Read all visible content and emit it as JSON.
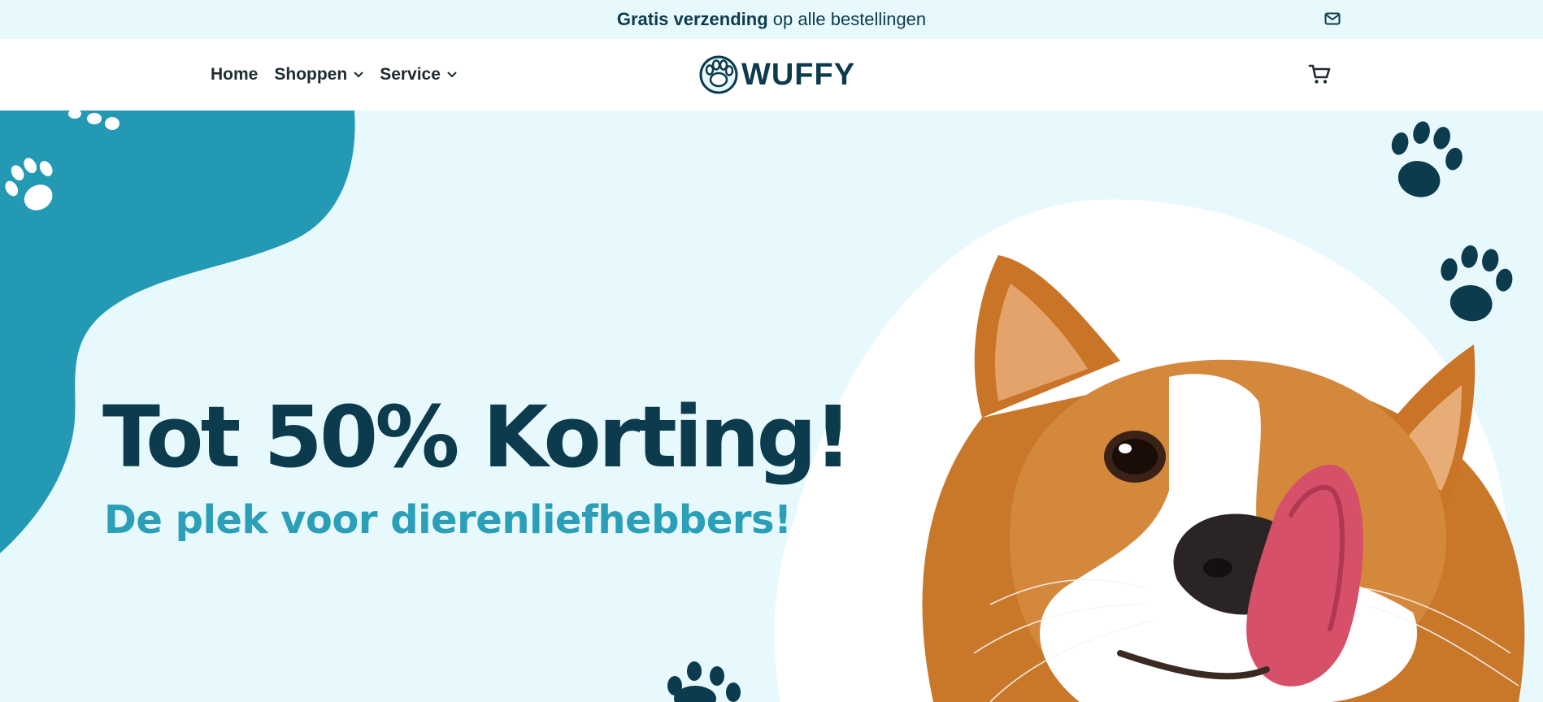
{
  "announcement": {
    "bold": "Gratis verzending",
    "rest": " op alle bestellingen",
    "mail_icon": "mail-icon"
  },
  "nav": {
    "items": [
      {
        "label": "Home",
        "has_dropdown": false
      },
      {
        "label": "Shoppen",
        "has_dropdown": true
      },
      {
        "label": "Service",
        "has_dropdown": true
      }
    ]
  },
  "logo": {
    "text": "WUFFY",
    "icon": "paw-icon"
  },
  "cart": {
    "icon": "cart-icon"
  },
  "hero": {
    "title": "Tot 50% Korting!",
    "subtitle": "De plek voor dierenliefhebbers!",
    "image": "corgi-licking-nose"
  },
  "colors": {
    "background": "#e8f9fd",
    "accent": "#2a9fb7",
    "dark": "#0b3b4c",
    "header": "#ffffff"
  }
}
